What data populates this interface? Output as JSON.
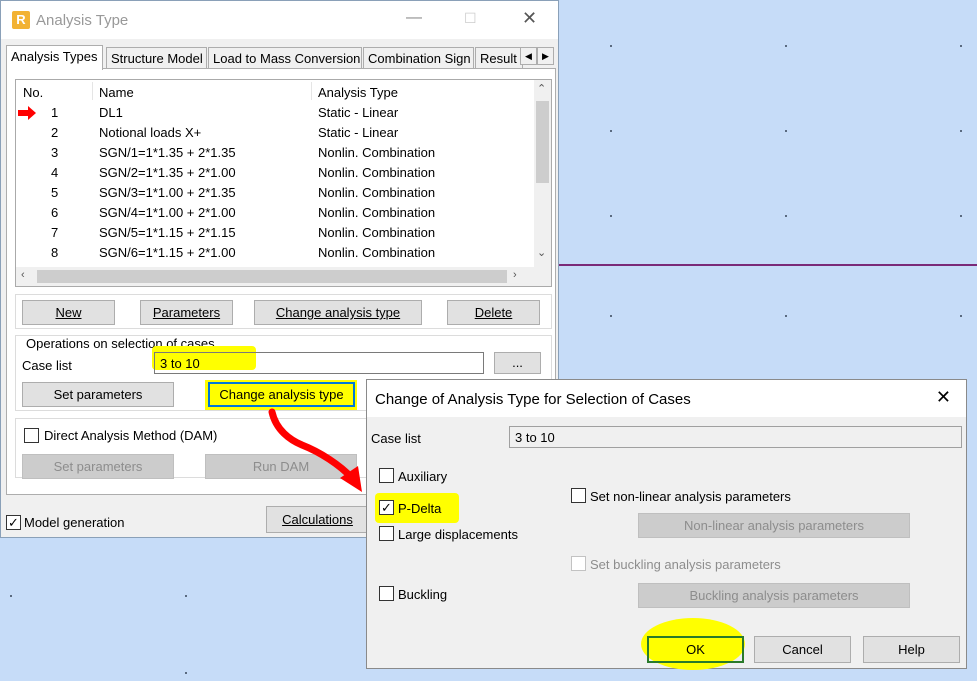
{
  "main_window": {
    "title": "Analysis Type",
    "app_icon_letter": "R",
    "tabs": [
      "Analysis Types",
      "Structure Model",
      "Load to Mass Conversion",
      "Combination Sign",
      "Result"
    ],
    "table": {
      "headers": [
        "No.",
        "Name",
        "Analysis Type"
      ],
      "rows": [
        {
          "no": "1",
          "name": "DL1",
          "type": "Static - Linear"
        },
        {
          "no": "2",
          "name": "Notional loads X+",
          "type": "Static - Linear"
        },
        {
          "no": "3",
          "name": "SGN/1=1*1.35 + 2*1.35",
          "type": "Nonlin. Combination"
        },
        {
          "no": "4",
          "name": "SGN/2=1*1.35 + 2*1.00",
          "type": "Nonlin. Combination"
        },
        {
          "no": "5",
          "name": "SGN/3=1*1.00 + 2*1.35",
          "type": "Nonlin. Combination"
        },
        {
          "no": "6",
          "name": "SGN/4=1*1.00 + 2*1.00",
          "type": "Nonlin. Combination"
        },
        {
          "no": "7",
          "name": "SGN/5=1*1.15 + 2*1.15",
          "type": "Nonlin. Combination"
        },
        {
          "no": "8",
          "name": "SGN/6=1*1.15 + 2*1.00",
          "type": "Nonlin. Combination"
        }
      ]
    },
    "buttons": {
      "new": "New",
      "parameters": "Parameters",
      "change_analysis_type": "Change analysis type",
      "delete": "Delete"
    },
    "operations": {
      "group_label": "Operations on selection of cases",
      "case_list_label": "Case list",
      "case_list_value": "3 to 10",
      "browse": "...",
      "set_parameters": "Set parameters",
      "change_analysis_type": "Change analysis type"
    },
    "dam": {
      "label": "Direct Analysis Method (DAM)",
      "set_parameters": "Set parameters",
      "run_dam": "Run DAM"
    },
    "model_generation": "Model generation",
    "calculations": "Calculations"
  },
  "dialog": {
    "title": "Change of Analysis Type for Selection of Cases",
    "case_list_label": "Case list",
    "case_list_value": "3 to 10",
    "options": {
      "auxiliary": "Auxiliary",
      "pdelta": "P-Delta",
      "large_displacements": "Large displacements",
      "buckling": "Buckling"
    },
    "nonlinear": {
      "checkbox": "Set non-linear analysis parameters",
      "button": "Non-linear analysis parameters"
    },
    "buckling_params": {
      "checkbox": "Set buckling analysis parameters",
      "button": "Buckling analysis parameters"
    },
    "ok": "OK",
    "cancel": "Cancel",
    "help": "Help"
  },
  "colors": {
    "highlight": "#ffff00",
    "annotation_arrow": "#ff0000",
    "desktop": "#c6dcf8"
  }
}
